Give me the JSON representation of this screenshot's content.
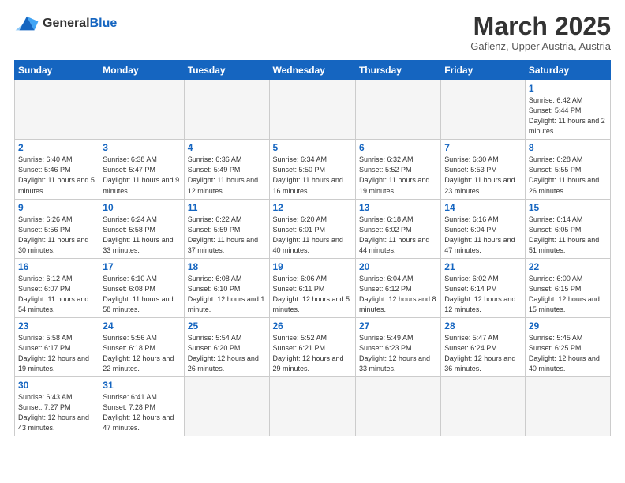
{
  "header": {
    "logo_general": "General",
    "logo_blue": "Blue",
    "month_title": "March 2025",
    "subtitle": "Gaflenz, Upper Austria, Austria"
  },
  "weekdays": [
    "Sunday",
    "Monday",
    "Tuesday",
    "Wednesday",
    "Thursday",
    "Friday",
    "Saturday"
  ],
  "days": [
    {
      "date": "",
      "info": ""
    },
    {
      "date": "",
      "info": ""
    },
    {
      "date": "",
      "info": ""
    },
    {
      "date": "",
      "info": ""
    },
    {
      "date": "",
      "info": ""
    },
    {
      "date": "",
      "info": ""
    },
    {
      "date": "1",
      "info": "Sunrise: 6:42 AM\nSunset: 5:44 PM\nDaylight: 11 hours and 2 minutes."
    },
    {
      "date": "2",
      "info": "Sunrise: 6:40 AM\nSunset: 5:46 PM\nDaylight: 11 hours and 5 minutes."
    },
    {
      "date": "3",
      "info": "Sunrise: 6:38 AM\nSunset: 5:47 PM\nDaylight: 11 hours and 9 minutes."
    },
    {
      "date": "4",
      "info": "Sunrise: 6:36 AM\nSunset: 5:49 PM\nDaylight: 11 hours and 12 minutes."
    },
    {
      "date": "5",
      "info": "Sunrise: 6:34 AM\nSunset: 5:50 PM\nDaylight: 11 hours and 16 minutes."
    },
    {
      "date": "6",
      "info": "Sunrise: 6:32 AM\nSunset: 5:52 PM\nDaylight: 11 hours and 19 minutes."
    },
    {
      "date": "7",
      "info": "Sunrise: 6:30 AM\nSunset: 5:53 PM\nDaylight: 11 hours and 23 minutes."
    },
    {
      "date": "8",
      "info": "Sunrise: 6:28 AM\nSunset: 5:55 PM\nDaylight: 11 hours and 26 minutes."
    },
    {
      "date": "9",
      "info": "Sunrise: 6:26 AM\nSunset: 5:56 PM\nDaylight: 11 hours and 30 minutes."
    },
    {
      "date": "10",
      "info": "Sunrise: 6:24 AM\nSunset: 5:58 PM\nDaylight: 11 hours and 33 minutes."
    },
    {
      "date": "11",
      "info": "Sunrise: 6:22 AM\nSunset: 5:59 PM\nDaylight: 11 hours and 37 minutes."
    },
    {
      "date": "12",
      "info": "Sunrise: 6:20 AM\nSunset: 6:01 PM\nDaylight: 11 hours and 40 minutes."
    },
    {
      "date": "13",
      "info": "Sunrise: 6:18 AM\nSunset: 6:02 PM\nDaylight: 11 hours and 44 minutes."
    },
    {
      "date": "14",
      "info": "Sunrise: 6:16 AM\nSunset: 6:04 PM\nDaylight: 11 hours and 47 minutes."
    },
    {
      "date": "15",
      "info": "Sunrise: 6:14 AM\nSunset: 6:05 PM\nDaylight: 11 hours and 51 minutes."
    },
    {
      "date": "16",
      "info": "Sunrise: 6:12 AM\nSunset: 6:07 PM\nDaylight: 11 hours and 54 minutes."
    },
    {
      "date": "17",
      "info": "Sunrise: 6:10 AM\nSunset: 6:08 PM\nDaylight: 11 hours and 58 minutes."
    },
    {
      "date": "18",
      "info": "Sunrise: 6:08 AM\nSunset: 6:10 PM\nDaylight: 12 hours and 1 minute."
    },
    {
      "date": "19",
      "info": "Sunrise: 6:06 AM\nSunset: 6:11 PM\nDaylight: 12 hours and 5 minutes."
    },
    {
      "date": "20",
      "info": "Sunrise: 6:04 AM\nSunset: 6:12 PM\nDaylight: 12 hours and 8 minutes."
    },
    {
      "date": "21",
      "info": "Sunrise: 6:02 AM\nSunset: 6:14 PM\nDaylight: 12 hours and 12 minutes."
    },
    {
      "date": "22",
      "info": "Sunrise: 6:00 AM\nSunset: 6:15 PM\nDaylight: 12 hours and 15 minutes."
    },
    {
      "date": "23",
      "info": "Sunrise: 5:58 AM\nSunset: 6:17 PM\nDaylight: 12 hours and 19 minutes."
    },
    {
      "date": "24",
      "info": "Sunrise: 5:56 AM\nSunset: 6:18 PM\nDaylight: 12 hours and 22 minutes."
    },
    {
      "date": "25",
      "info": "Sunrise: 5:54 AM\nSunset: 6:20 PM\nDaylight: 12 hours and 26 minutes."
    },
    {
      "date": "26",
      "info": "Sunrise: 5:52 AM\nSunset: 6:21 PM\nDaylight: 12 hours and 29 minutes."
    },
    {
      "date": "27",
      "info": "Sunrise: 5:49 AM\nSunset: 6:23 PM\nDaylight: 12 hours and 33 minutes."
    },
    {
      "date": "28",
      "info": "Sunrise: 5:47 AM\nSunset: 6:24 PM\nDaylight: 12 hours and 36 minutes."
    },
    {
      "date": "29",
      "info": "Sunrise: 5:45 AM\nSunset: 6:25 PM\nDaylight: 12 hours and 40 minutes."
    },
    {
      "date": "30",
      "info": "Sunrise: 6:43 AM\nSunset: 7:27 PM\nDaylight: 12 hours and 43 minutes."
    },
    {
      "date": "31",
      "info": "Sunrise: 6:41 AM\nSunset: 7:28 PM\nDaylight: 12 hours and 47 minutes."
    },
    {
      "date": "",
      "info": ""
    },
    {
      "date": "",
      "info": ""
    },
    {
      "date": "",
      "info": ""
    },
    {
      "date": "",
      "info": ""
    },
    {
      "date": "",
      "info": ""
    }
  ]
}
